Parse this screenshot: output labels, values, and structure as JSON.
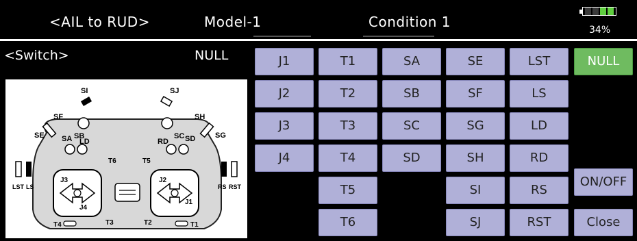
{
  "header": {
    "screen_title": "<AIL to RUD>",
    "model": "Model-1",
    "condition": "Condition 1",
    "battery_percent": "34%",
    "battery_level": 0.6,
    "battery_color": "#5fcf3f"
  },
  "switch": {
    "label": "<Switch>",
    "value": "NULL"
  },
  "diagram": {
    "labels": {
      "SI": "SI",
      "SJ": "SJ",
      "SF": "SF",
      "SH": "SH",
      "SE": "SE",
      "SG": "SG",
      "SA": "SA",
      "SB": "SB",
      "SC": "SC",
      "SD": "SD",
      "LD": "LD",
      "RD": "RD",
      "T6": "T6",
      "T5": "T5",
      "J3": "J3",
      "J4": "J4",
      "J2": "J2",
      "J1": "J1",
      "LST": "LST",
      "LS": "LS",
      "RS": "RS",
      "RST": "RST",
      "T4": "T4",
      "T3": "T3",
      "T2": "T2",
      "T1": "T1"
    }
  },
  "buttons": {
    "J1": "J1",
    "J2": "J2",
    "J3": "J3",
    "J4": "J4",
    "T1": "T1",
    "T2": "T2",
    "T3": "T3",
    "T4": "T4",
    "T5": "T5",
    "T6": "T6",
    "SA": "SA",
    "SB": "SB",
    "SC": "SC",
    "SD": "SD",
    "SE": "SE",
    "SF": "SF",
    "SG": "SG",
    "SH": "SH",
    "SI": "SI",
    "SJ": "SJ",
    "LST": "LST",
    "LS": "LS",
    "LD": "LD",
    "RD": "RD",
    "RS": "RS",
    "RST": "RST",
    "NULL": "NULL",
    "ONOFF": "ON/OFF",
    "CLOSE": "Close"
  },
  "colors": {
    "button_bg": "#b0b0d8",
    "selected_bg": "#6fbb60"
  }
}
